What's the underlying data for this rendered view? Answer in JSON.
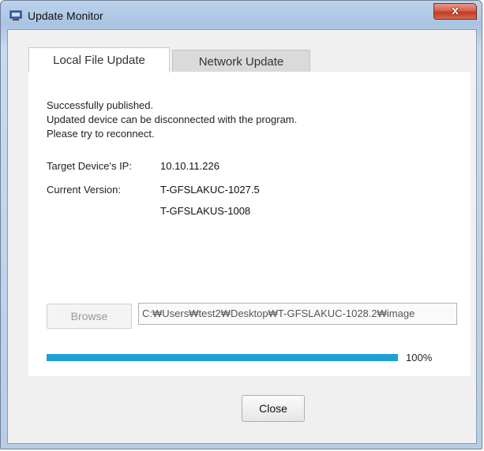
{
  "window": {
    "title": "Update Monitor",
    "close_glyph": "x",
    "icon": "monitor-icon"
  },
  "tabs": [
    {
      "label": "Local File Update",
      "selected": true
    },
    {
      "label": "Network Update",
      "selected": false
    }
  ],
  "message": {
    "lines": [
      "Successfully published.",
      "Updated device can be disconnected with the program.",
      "Please try to reconnect."
    ]
  },
  "device": {
    "ip_label": "Target Device's IP:",
    "ip_value": "10.10.11.226",
    "version_label": "Current Version:",
    "versions": [
      "T-GFSLAKUC-1027.5",
      "T-GFSLAKUS-1008"
    ]
  },
  "file": {
    "browse_label": "Browse",
    "browse_enabled": false,
    "path_value": "C:₩Users₩test2₩Desktop₩T-GFSLAKUC-1028.2₩image"
  },
  "progress": {
    "fraction": 1.0,
    "text": "100%",
    "color": "#1f9fd3"
  },
  "footer": {
    "close_label": "Close"
  }
}
